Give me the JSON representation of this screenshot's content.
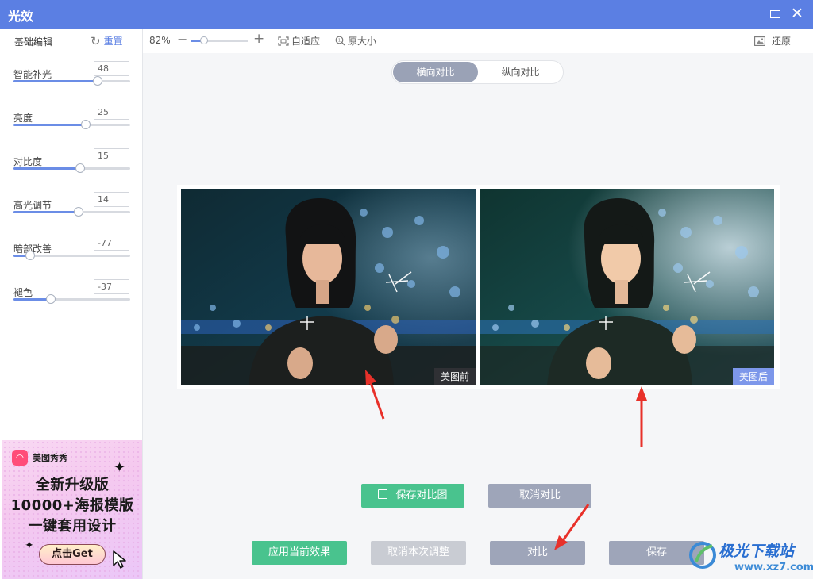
{
  "window": {
    "title": "光效",
    "maximize_icon": "maximize-icon",
    "close_icon": "close-icon",
    "close_glyph": "✕"
  },
  "sidebar": {
    "title": "基础编辑",
    "reset_label": "重置",
    "reset_glyph": "↻",
    "adjustments": [
      {
        "label": "智能补光",
        "value": "48",
        "level": 0.72
      },
      {
        "label": "亮度",
        "value": "25",
        "level": 0.62
      },
      {
        "label": "对比度",
        "value": "15",
        "level": 0.57
      },
      {
        "label": "高光调节",
        "value": "14",
        "level": 0.56
      },
      {
        "label": "暗部改善",
        "value": "-77",
        "level": 0.14
      },
      {
        "label": "褪色",
        "value": "-37",
        "level": 0.32
      }
    ]
  },
  "ad": {
    "brand": "美图秀秀",
    "line1": "全新升级版",
    "line2": "10000+海报模版",
    "line3": "一键套用设计",
    "cta": "点击Get"
  },
  "toolbar": {
    "zoom": "82%",
    "zoom_level": 0.23,
    "minus_glyph": "−",
    "plus_glyph": "+",
    "fit_label": "自适应",
    "original_size_label": "原大小",
    "restore_label": "还原"
  },
  "compare": {
    "tab_horizontal": "横向对比",
    "tab_vertical": "纵向对比",
    "before_tag": "美图前",
    "after_tag": "美图后"
  },
  "buttons": {
    "save_compare": "保存对比图",
    "cancel_compare": "取消对比",
    "apply_current": "应用当前效果",
    "cancel_adjust": "取消本次调整",
    "compare": "对比",
    "save": "保存"
  },
  "watermark": {
    "text": "极光下载站",
    "url": "www.xz7.com"
  },
  "colors": {
    "accent": "#5b7fe3",
    "green": "#49c38e",
    "grey_button": "#9ea5b9",
    "arrow_red": "#e8312a"
  }
}
